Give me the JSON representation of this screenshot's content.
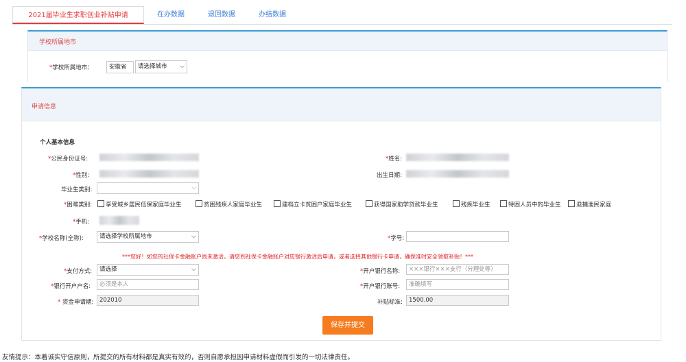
{
  "tabs": [
    {
      "label": "2021届毕业生求职创业补贴申请",
      "active": true
    },
    {
      "label": "在办数据",
      "active": false
    },
    {
      "label": "退回数据",
      "active": false
    },
    {
      "label": "办结数据",
      "active": false
    }
  ],
  "section1": {
    "title": "学校所属地市",
    "city_label": "学校所属地市：",
    "province_value": "安徽省",
    "city_select_value": "请选择城市"
  },
  "section2": {
    "title": "申请信息",
    "subtitle": "个人基本信息",
    "labels": {
      "id_no": "公民身份证号:",
      "name": "姓名:",
      "gender": "性别:",
      "birth": "出生日期:",
      "grad_type": "毕业生类别:",
      "hardship": "困难类别:",
      "phone": "手机:",
      "school": "学校名称(全称):",
      "student_no": "学号:",
      "pay_method": "支付方式:",
      "bank_name": "开户银行名称:",
      "account_name": "银行开户户名:",
      "account_no": "开户银行账号:",
      "fund_period": "资金申请期:",
      "subsidy": "补贴标准:"
    },
    "hardship_options": [
      "享受城乡居民低保家庭毕业生",
      "贫困残疾人家庭毕业生",
      "建档立卡贫困户家庭毕业生",
      "获得国家助学贷款毕业生",
      "残疾毕业生",
      "特困人员中的毕业生",
      "退捕渔民家庭"
    ],
    "school_select_value": "请选择学校所属地市",
    "notice": "***您好！如您的社保卡金融账户尚未激活，请您到社保卡金融账户对应银行激活后申请，或者选择其他银行卡申请，确保准时安全领取补贴！***",
    "pay_method_value": "请选择",
    "bank_name_placeholder": "×××银行×××支行（分理处等）",
    "account_name_placeholder": "必须是本人",
    "account_no_placeholder": "准确填写",
    "fund_period_value": "202010",
    "subsidy_value": "1500.00",
    "submit_label": "保存并提交"
  },
  "footer_text": "友情提示：本着诚实守信原则，所提交的所有材料都是真实有效的，否则自愿承担因申请材料虚假而引发的一切法律责任。"
}
